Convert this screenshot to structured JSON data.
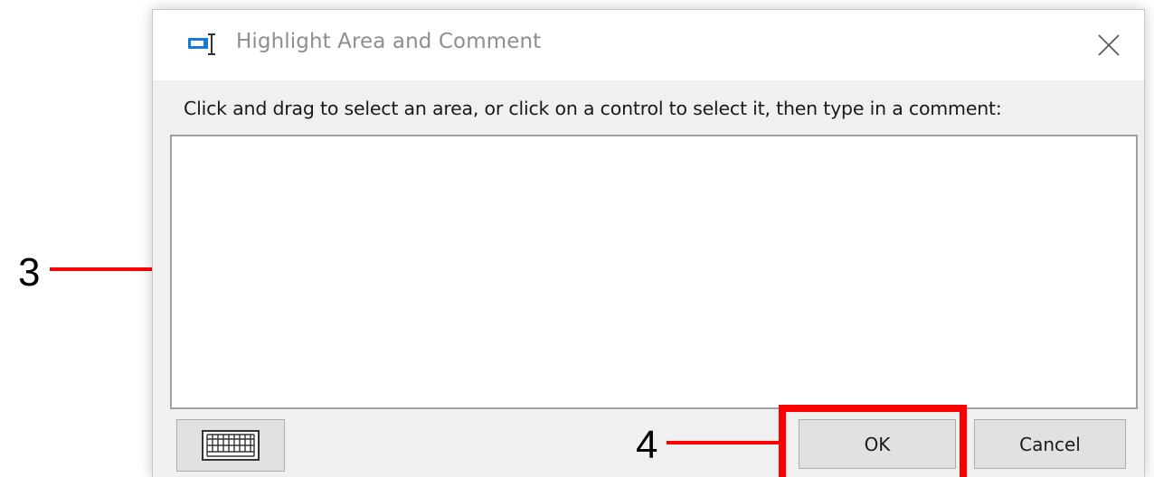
{
  "dialog": {
    "title": "Highlight Area and Comment",
    "instruction": "Click and drag to select an area, or click on a control to select it, then type in a comment:",
    "comment_value": "",
    "ok_label": "OK",
    "cancel_label": "Cancel",
    "icons": {
      "app": "highlight-comment-icon",
      "close": "close-icon",
      "keyboard": "keyboard-icon"
    }
  },
  "annotations": {
    "callout_3": "3",
    "callout_4": "4",
    "highlight_color": "#ff0000"
  },
  "colors": {
    "app_icon_blue": "#1e78d7",
    "title_text": "#8e8e8e",
    "dialog_background": "#f0f0f0",
    "button_background": "#e1e1e1"
  }
}
